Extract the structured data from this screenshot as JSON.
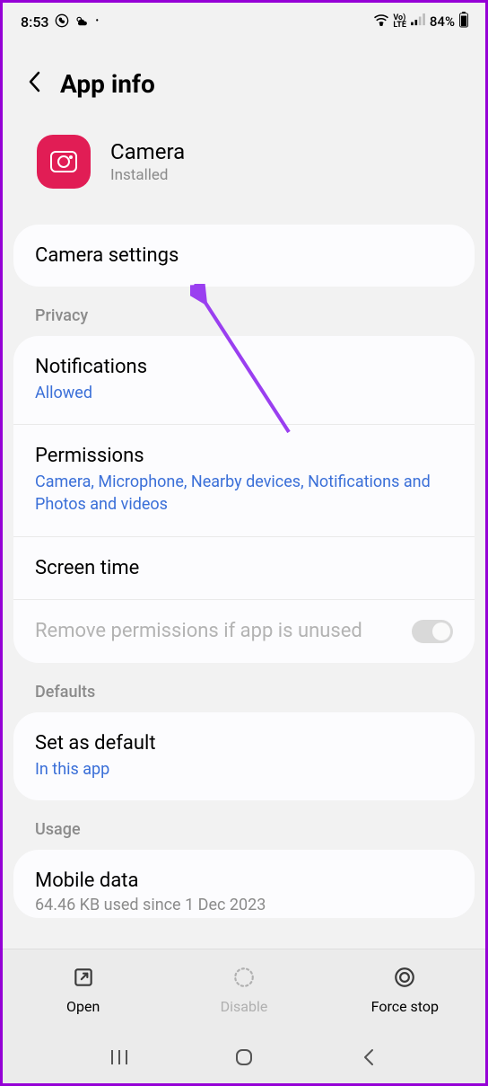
{
  "status": {
    "time": "8:53",
    "battery_text": "84%"
  },
  "header": {
    "title": "App info"
  },
  "app": {
    "name": "Camera",
    "status": "Installed"
  },
  "rows": {
    "camera_settings": "Camera settings",
    "privacy_label": "Privacy",
    "notifications": {
      "title": "Notifications",
      "sub": "Allowed"
    },
    "permissions": {
      "title": "Permissions",
      "sub": "Camera, Microphone, Nearby devices, Notifications and Photos and videos"
    },
    "screen_time": "Screen time",
    "remove_perms": "Remove permissions if app is unused",
    "defaults_label": "Defaults",
    "set_default": {
      "title": "Set as default",
      "sub": "In this app"
    },
    "usage_label": "Usage",
    "mobile_data": {
      "title": "Mobile data",
      "sub": "64.46 KB used since 1 Dec 2023"
    }
  },
  "actions": {
    "open": "Open",
    "disable": "Disable",
    "force_stop": "Force stop"
  }
}
